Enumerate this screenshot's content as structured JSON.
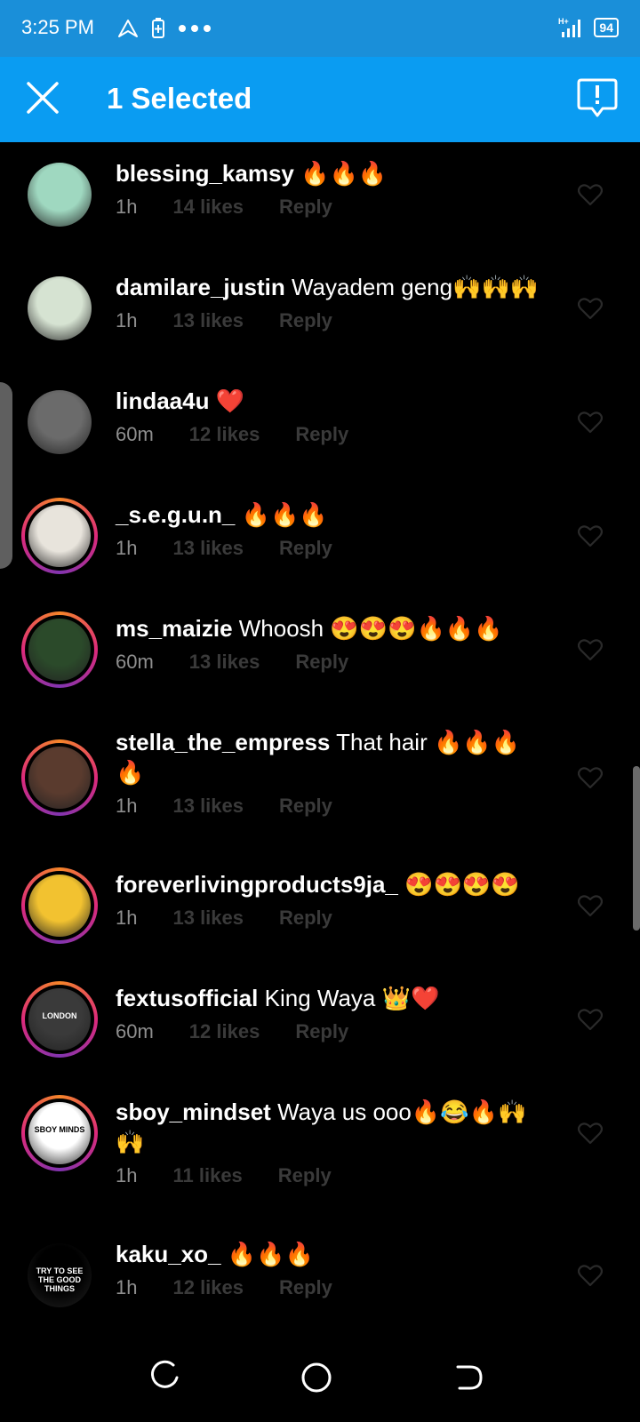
{
  "status_bar": {
    "time": "3:25 PM",
    "battery": "94"
  },
  "app_bar": {
    "title": "1 Selected"
  },
  "comments": [
    {
      "username": "blessing_kamsy",
      "text": "🔥🔥🔥",
      "time": "1h",
      "likes": "14 likes",
      "reply": "Reply",
      "ring": false,
      "avatar_color": "#9fd8c0"
    },
    {
      "username": "damilare_justin",
      "text": "Wayadem geng🙌🙌🙌",
      "time": "1h",
      "likes": "13 likes",
      "reply": "Reply",
      "ring": false,
      "avatar_color": "#d6e3d2"
    },
    {
      "username": "lindaa4u",
      "text": "❤️",
      "time": "60m",
      "likes": "12 likes",
      "reply": "Reply",
      "ring": false,
      "avatar_color": "#6b6b6b"
    },
    {
      "username": "_s.e.g.u.n_",
      "text": "🔥🔥🔥",
      "time": "1h",
      "likes": "13 likes",
      "reply": "Reply",
      "ring": true,
      "avatar_color": "#e8e4dc"
    },
    {
      "username": "ms_maizie",
      "text": "Whoosh 😍😍😍🔥🔥🔥",
      "time": "60m",
      "likes": "13 likes",
      "reply": "Reply",
      "ring": true,
      "avatar_color": "#2b4a2a"
    },
    {
      "username": "stella_the_empress",
      "text": "That hair 🔥🔥🔥 🔥",
      "time": "1h",
      "likes": "13 likes",
      "reply": "Reply",
      "ring": true,
      "avatar_color": "#5a3b2e"
    },
    {
      "username": "foreverlivingproducts9ja_",
      "text": "😍😍😍😍",
      "time": "1h",
      "likes": "13 likes",
      "reply": "Reply",
      "ring": true,
      "avatar_color": "#f2c230"
    },
    {
      "username": "fextusofficial",
      "text": "King Waya 👑❤️",
      "time": "60m",
      "likes": "12 likes",
      "reply": "Reply",
      "ring": true,
      "avatar_color": "#3a3a3a",
      "avatar_text": "LONDON"
    },
    {
      "username": "sboy_mindset",
      "text": "Waya us ooo🔥😂🔥🙌 🙌",
      "time": "1h",
      "likes": "11 likes",
      "reply": "Reply",
      "ring": true,
      "avatar_color": "#ffffff",
      "avatar_text": "SBOY MINDS"
    },
    {
      "username": "kaku_xo_",
      "text": "🔥🔥🔥",
      "time": "1h",
      "likes": "12 likes",
      "reply": "Reply",
      "ring": false,
      "avatar_color": "#000000",
      "avatar_text": "TRY TO SEE THE GOOD THINGS"
    }
  ],
  "colors": {
    "status_bar": "#1a8fd9",
    "app_bar": "#0a9cf2",
    "background": "#000000"
  }
}
